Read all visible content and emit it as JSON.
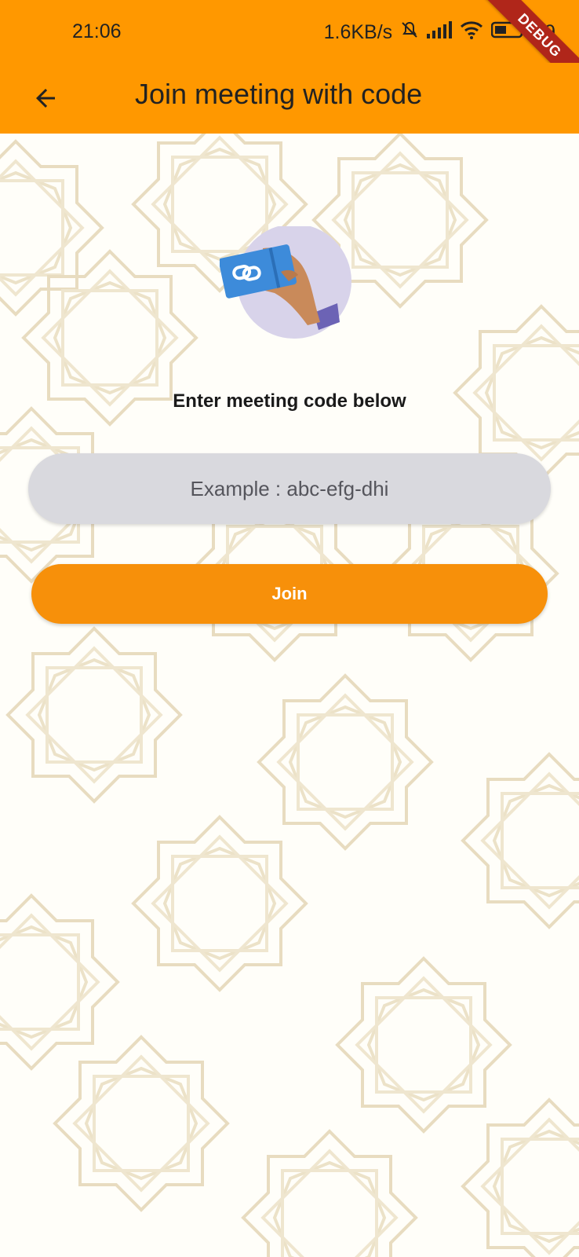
{
  "status_bar": {
    "time": "21:06",
    "network_speed": "1.6KB/s",
    "battery_percent": "39",
    "icons": [
      "bell-muted-icon",
      "signal-icon",
      "wifi-icon",
      "battery-icon"
    ]
  },
  "debug_banner": "DEBUG",
  "app_bar": {
    "title": "Join meeting with code",
    "back_icon": "arrow-back-icon",
    "background_color": "#FF9800"
  },
  "main": {
    "illustration_icon": "hand-holding-link-card-icon",
    "prompt": "Enter meeting code below",
    "code_input": {
      "value": "",
      "placeholder": "Example : abc-efg-dhi"
    },
    "join_label": "Join",
    "accent_color": "#F7900A"
  }
}
